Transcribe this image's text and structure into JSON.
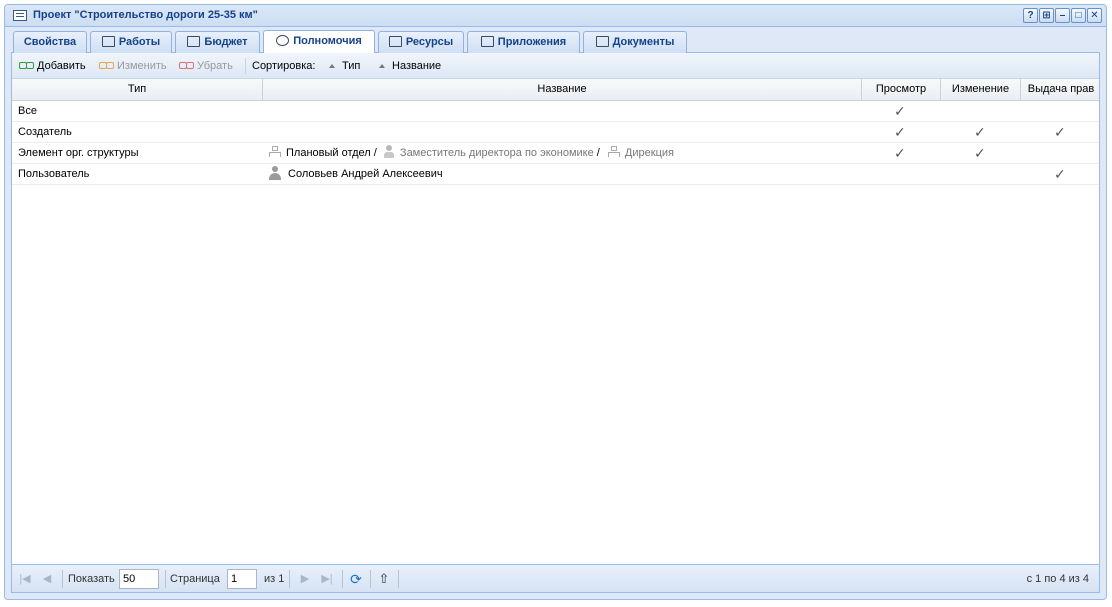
{
  "window": {
    "title": "Проект \"Строительство дороги 25-35 км\"",
    "tools": [
      "?",
      "⊞",
      "–",
      "□",
      "✕"
    ]
  },
  "tabs": [
    {
      "label": "Свойства",
      "icon": "none"
    },
    {
      "label": "Работы",
      "icon": "tasks-icon"
    },
    {
      "label": "Бюджет",
      "icon": "money-icon"
    },
    {
      "label": "Полномочия",
      "icon": "user-rights-icon",
      "active": true
    },
    {
      "label": "Ресурсы",
      "icon": "chart-icon"
    },
    {
      "label": "Приложения",
      "icon": "attachment-icon"
    },
    {
      "label": "Документы",
      "icon": "folder-icon"
    }
  ],
  "toolbar": {
    "add_label": "Добавить",
    "edit_label": "Изменить",
    "remove_label": "Убрать",
    "sort_label": "Сортировка:",
    "sort_type_label": "Тип",
    "sort_name_label": "Название"
  },
  "grid": {
    "columns": [
      "Тип",
      "Название",
      "Просмотр",
      "Изменение",
      "Выдача прав"
    ],
    "check_mark": "✓",
    "rows": [
      {
        "type": "Все",
        "view": true,
        "edit": false,
        "grant": false
      },
      {
        "type": "Создатель",
        "view": true,
        "edit": true,
        "grant": true
      },
      {
        "type": "Элемент орг. структуры",
        "view": true,
        "edit": true,
        "grant": false,
        "name_parts": [
          {
            "icon": "org-unit-icon",
            "text": "Плановый отдел",
            "sep": " /",
            "muted": false
          },
          {
            "icon": "position-icon",
            "text": "Заместитель директора по экономике",
            "sep": " /",
            "muted": true
          },
          {
            "icon": "org-unit-icon",
            "text": "Дирекция",
            "sep": "",
            "muted": true
          }
        ]
      },
      {
        "type": "Пользователь",
        "view": false,
        "edit": false,
        "grant": true,
        "user_name": "Соловьев Андрей Алексеевич"
      }
    ]
  },
  "pager": {
    "show_label": "Показать",
    "page_size": "50",
    "page_label": "Страница",
    "page_value": "1",
    "of_label": "из 1",
    "summary": "с 1 по 4 из 4"
  }
}
